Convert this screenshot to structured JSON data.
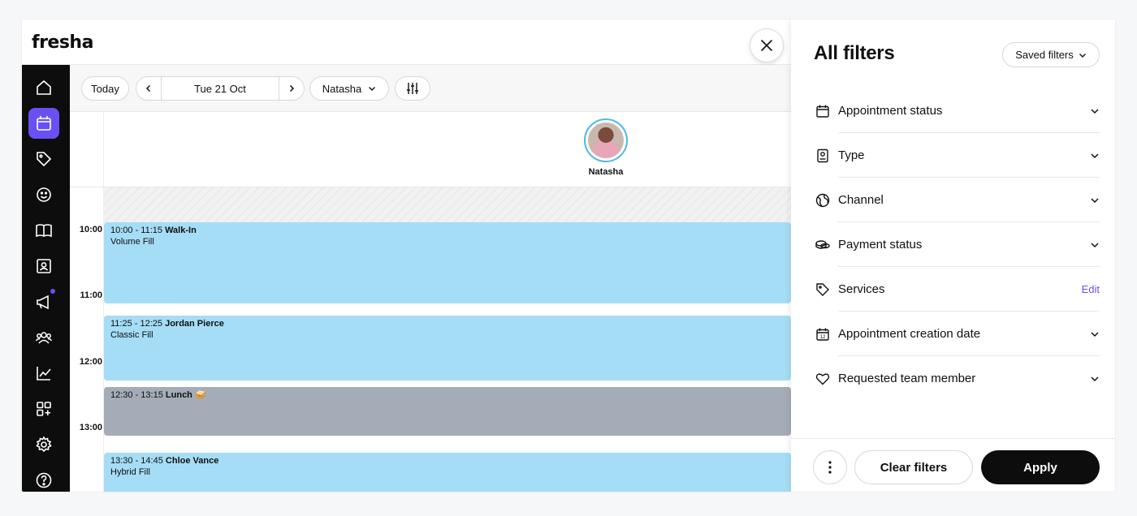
{
  "app": {
    "logo_text": "fresha"
  },
  "sidebar": {
    "items": [
      {
        "icon": "home-icon"
      },
      {
        "icon": "calendar-icon",
        "active": true
      },
      {
        "icon": "tag-icon"
      },
      {
        "icon": "smiley-icon"
      },
      {
        "icon": "book-icon"
      },
      {
        "icon": "user-card-icon"
      },
      {
        "icon": "megaphone-icon",
        "badge": true
      },
      {
        "icon": "team-icon"
      },
      {
        "icon": "chart-icon"
      },
      {
        "icon": "apps-add-icon"
      },
      {
        "icon": "gear-icon"
      },
      {
        "icon": "help-icon"
      }
    ]
  },
  "toolbar": {
    "today_label": "Today",
    "date_label": "Tue 21 Oct",
    "staff_select": "Natasha"
  },
  "staff": {
    "name": "Natasha"
  },
  "calendar": {
    "times": [
      "10:00",
      "11:00",
      "12:00",
      "13:00"
    ],
    "appointments": [
      {
        "time": "10:00 - 11:15",
        "client": "Walk-In",
        "service": "Volume Fill",
        "color": "#a5ddf6"
      },
      {
        "time": "11:25 - 12:25",
        "client": "Jordan Pierce",
        "service": "Classic Fill",
        "color": "#a5ddf6"
      },
      {
        "time": "12:30 - 13:15",
        "client": "Lunch 🥪",
        "service": "",
        "color": "#a4acb7"
      },
      {
        "time": "13:30 - 14:45",
        "client": "Chloe Vance",
        "service": "Hybrid Fill",
        "color": "#a5ddf6"
      }
    ]
  },
  "filters": {
    "title": "All filters",
    "saved_filters_label": "Saved filters",
    "rows": [
      {
        "label": "Appointment status",
        "icon": "calendar-icon"
      },
      {
        "label": "Type",
        "icon": "id-badge-icon"
      },
      {
        "label": "Channel",
        "icon": "globe-icon"
      },
      {
        "label": "Payment status",
        "icon": "coins-icon"
      },
      {
        "label": "Services",
        "icon": "tag-icon",
        "action": "Edit"
      },
      {
        "label": "Appointment creation date",
        "icon": "calendar-date-icon",
        "date_number": "12"
      },
      {
        "label": "Requested team member",
        "icon": "heart-icon"
      }
    ],
    "clear_label": "Clear filters",
    "apply_label": "Apply"
  },
  "colors": {
    "accent": "#6950f3",
    "appointment_blue": "#a5ddf6",
    "break_grey": "#a4acb7",
    "sidebar_bg": "#0d0d0d"
  }
}
